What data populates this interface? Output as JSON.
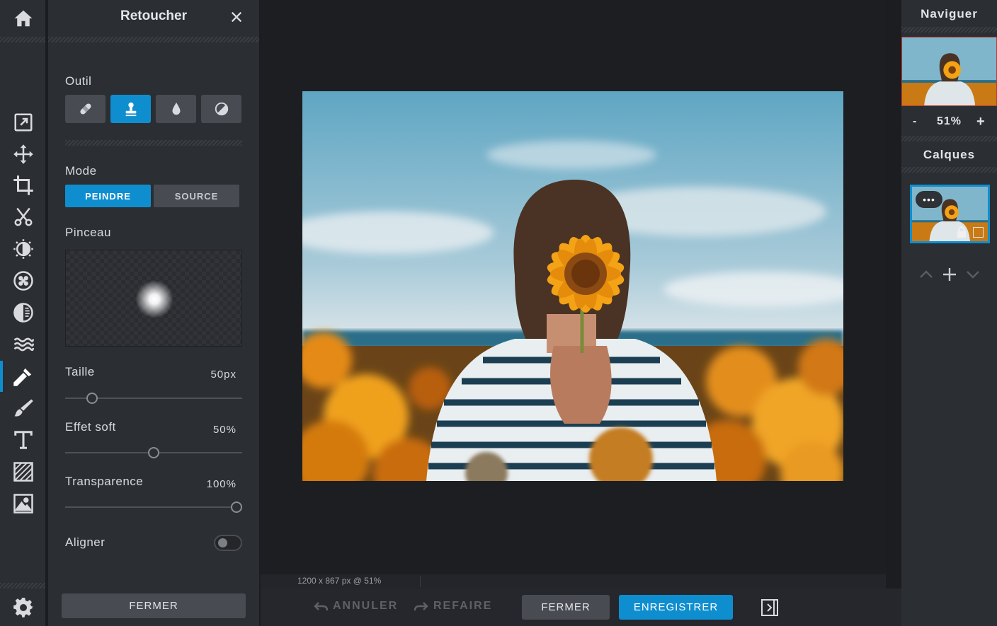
{
  "panel": {
    "title": "Retoucher",
    "tool_label": "Outil",
    "tools": [
      "bandage-icon",
      "stamp-icon",
      "drop-icon",
      "contrast-icon"
    ],
    "mode_label": "Mode",
    "modes": [
      "PEINDRE",
      "SOURCE"
    ],
    "brush_label": "Pinceau",
    "size": {
      "label": "Taille",
      "value": "50px",
      "fraction": 0.13
    },
    "soft": {
      "label": "Effet soft",
      "value": "50%",
      "fraction": 0.5
    },
    "opacity": {
      "label": "Transparence",
      "value": "100%",
      "fraction": 1.0
    },
    "align": {
      "label": "Aligner",
      "on": false
    },
    "close_label": "FERMER"
  },
  "canvas": {
    "status": "1200 x 867 px @ 51%"
  },
  "bottom": {
    "undo": "ANNULER",
    "redo": "REFAIRE",
    "close": "FERMER",
    "save": "ENREGISTRER"
  },
  "right": {
    "navigator_title": "Naviguer",
    "zoom_minus": "-",
    "zoom_value": "51%",
    "zoom_plus": "+",
    "layers_title": "Calques",
    "layer_more": "•••"
  },
  "colors": {
    "accent": "#0f8ecf",
    "panel": "#2b2e33",
    "canvas": "#1c1e22"
  }
}
